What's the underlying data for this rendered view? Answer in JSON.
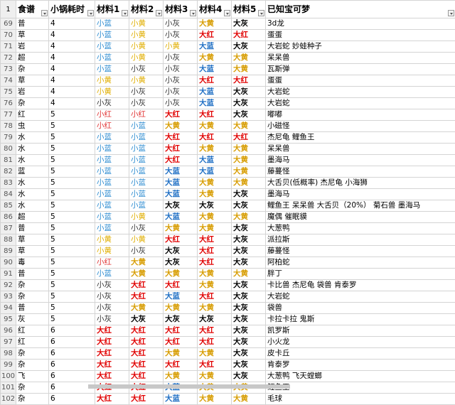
{
  "header": {
    "row_number": "1",
    "columns": [
      "食谱",
      "小锅耗时",
      "材料1",
      "材料2",
      "材料3",
      "材料4",
      "材料5",
      "已知宝可梦"
    ]
  },
  "ingredient_colors": {
    "蓝": "#1f6fc4",
    "黄": "#d79c00",
    "红": "#e00000",
    "灰": "#000000"
  },
  "rows": [
    {
      "n": "69",
      "type": "普",
      "time": "4",
      "m": [
        "小蓝",
        "小黄",
        "小灰",
        "大黄",
        "大灰"
      ],
      "pk": "3d龙"
    },
    {
      "n": "70",
      "type": "草",
      "time": "4",
      "m": [
        "小蓝",
        "小黄",
        "小灰",
        "大红",
        "大红"
      ],
      "pk": "蛋蛋"
    },
    {
      "n": "71",
      "type": "岩",
      "time": "4",
      "m": [
        "小蓝",
        "小黄",
        "小黄",
        "大蓝",
        "大灰"
      ],
      "pk": "大岩蛇 妙蛙种子"
    },
    {
      "n": "72",
      "type": "超",
      "time": "4",
      "m": [
        "小蓝",
        "小黄",
        "小灰",
        "大黄",
        "大黄"
      ],
      "pk": "呆呆兽"
    },
    {
      "n": "73",
      "type": "杂",
      "time": "4",
      "m": [
        "小蓝",
        "小灰",
        "小灰",
        "大蓝",
        "大黄"
      ],
      "pk": "瓦斯弹"
    },
    {
      "n": "74",
      "type": "草",
      "time": "4",
      "m": [
        "小黄",
        "小黄",
        "小灰",
        "大红",
        "大红"
      ],
      "pk": "蛋蛋"
    },
    {
      "n": "75",
      "type": "岩",
      "time": "4",
      "m": [
        "小黄",
        "小灰",
        "小灰",
        "大蓝",
        "大灰"
      ],
      "pk": "大岩蛇"
    },
    {
      "n": "76",
      "type": "杂",
      "time": "4",
      "m": [
        "小灰",
        "小灰",
        "小灰",
        "大蓝",
        "大灰"
      ],
      "pk": "大岩蛇"
    },
    {
      "n": "77",
      "type": "红",
      "time": "5",
      "m": [
        "小红",
        "小红",
        "大红",
        "大红",
        "大灰"
      ],
      "pk": "嘟嘟"
    },
    {
      "n": "78",
      "type": "虫",
      "time": "5",
      "m": [
        "小红",
        "小蓝",
        "大黄",
        "大黄",
        "大黄"
      ],
      "pk": "小磁怪"
    },
    {
      "n": "79",
      "type": "水",
      "time": "5",
      "m": [
        "小蓝",
        "小蓝",
        "大红",
        "大红",
        "大红"
      ],
      "pk": "杰尼龟 鲤鱼王"
    },
    {
      "n": "80",
      "type": "水",
      "time": "5",
      "m": [
        "小蓝",
        "小蓝",
        "大红",
        "大黄",
        "大黄"
      ],
      "pk": "呆呆兽"
    },
    {
      "n": "81",
      "type": "水",
      "time": "5",
      "m": [
        "小蓝",
        "小蓝",
        "大红",
        "大蓝",
        "大黄"
      ],
      "pk": "墨海马"
    },
    {
      "n": "82",
      "type": "蓝",
      "time": "5",
      "m": [
        "小蓝",
        "小蓝",
        "大蓝",
        "大蓝",
        "大黄"
      ],
      "pk": "藤蔓怪"
    },
    {
      "n": "83",
      "type": "水",
      "time": "5",
      "m": [
        "小蓝",
        "小蓝",
        "大蓝",
        "大黄",
        "大黄"
      ],
      "pk": "大舌贝(低概率) 杰尼龟 小海狮"
    },
    {
      "n": "84",
      "type": "水",
      "time": "5",
      "m": [
        "小蓝",
        "小蓝",
        "大蓝",
        "大黄",
        "大灰"
      ],
      "pk": "墨海马"
    },
    {
      "n": "85",
      "type": "水",
      "time": "5",
      "m": [
        "小蓝",
        "小蓝",
        "大灰",
        "大灰",
        "大灰"
      ],
      "pk": "鲤鱼王 呆呆兽 大舌贝（20%） 菊石兽 墨海马"
    },
    {
      "n": "86",
      "type": "超",
      "time": "5",
      "m": [
        "小蓝",
        "小黄",
        "大蓝",
        "大黄",
        "大黄"
      ],
      "pk": "魔偶 催眠貘"
    },
    {
      "n": "87",
      "type": "普",
      "time": "5",
      "m": [
        "小蓝",
        "小灰",
        "大黄",
        "大黄",
        "大灰"
      ],
      "pk": "大葱鸭"
    },
    {
      "n": "88",
      "type": "草",
      "time": "5",
      "m": [
        "小黄",
        "小黄",
        "大红",
        "大红",
        "大灰"
      ],
      "pk": "派拉斯"
    },
    {
      "n": "89",
      "type": "草",
      "time": "5",
      "m": [
        "小黄",
        "小灰",
        "大灰",
        "大红",
        "大灰"
      ],
      "pk": "藤蔓怪"
    },
    {
      "n": "90",
      "type": "毒",
      "time": "5",
      "m": [
        "小红",
        "大黄",
        "大灰",
        "大红",
        "大灰"
      ],
      "pk": "阿柏蛇"
    },
    {
      "n": "91",
      "type": "普",
      "time": "5",
      "m": [
        "小蓝",
        "大黄",
        "大黄",
        "大黄",
        "大黄"
      ],
      "pk": "胖丁"
    },
    {
      "n": "92",
      "type": "杂",
      "time": "5",
      "m": [
        "小灰",
        "大红",
        "大红",
        "大黄",
        "大灰"
      ],
      "pk": "卡比兽 杰尼龟 袋兽 肯泰罗"
    },
    {
      "n": "93",
      "type": "杂",
      "time": "5",
      "m": [
        "小灰",
        "大红",
        "大蓝",
        "大红",
        "大灰"
      ],
      "pk": "大岩蛇"
    },
    {
      "n": "94",
      "type": "普",
      "time": "5",
      "m": [
        "小灰",
        "大黄",
        "大黄",
        "大黄",
        "大灰"
      ],
      "pk": "袋兽"
    },
    {
      "n": "95",
      "type": "灰",
      "time": "5",
      "m": [
        "小灰",
        "大灰",
        "大灰",
        "大灰",
        "大灰"
      ],
      "pk": "卡拉卡拉 鬼斯"
    },
    {
      "n": "96",
      "type": "红",
      "time": "6",
      "m": [
        "大红",
        "大红",
        "大红",
        "大红",
        "大灰"
      ],
      "pk": "凯罗斯"
    },
    {
      "n": "97",
      "type": "红",
      "time": "6",
      "m": [
        "大红",
        "大红",
        "大红",
        "大红",
        "大灰"
      ],
      "pk": "小火龙"
    },
    {
      "n": "98",
      "type": "杂",
      "time": "6",
      "m": [
        "大红",
        "大红",
        "大黄",
        "大黄",
        "大灰"
      ],
      "pk": "皮卡丘"
    },
    {
      "n": "99",
      "type": "杂",
      "time": "6",
      "m": [
        "大红",
        "大红",
        "大红",
        "大红",
        "大灰"
      ],
      "pk": "肯泰罗"
    },
    {
      "n": "100",
      "type": "飞",
      "time": "6",
      "m": [
        "大红",
        "大红",
        "大黄",
        "大黄",
        "大灰"
      ],
      "pk": "大葱鸭 飞天螳螂"
    },
    {
      "n": "101",
      "type": "杂",
      "time": "6",
      "m": [
        "大红",
        "大红",
        "大蓝",
        "大黄",
        "大黄"
      ],
      "pk": "鲤鱼王"
    },
    {
      "n": "102",
      "type": "杂",
      "time": "6",
      "m": [
        "大红",
        "大红",
        "大蓝",
        "大黄",
        "大黄"
      ],
      "pk": "毛球"
    }
  ]
}
